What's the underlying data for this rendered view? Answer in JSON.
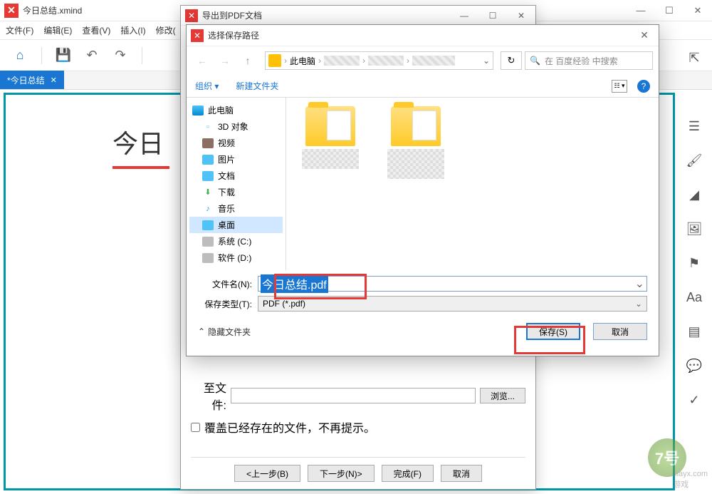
{
  "main": {
    "title": "今日总结.xmind",
    "menu": [
      "文件(F)",
      "编辑(E)",
      "查看(V)",
      "插入(I)",
      "修改("
    ],
    "tab_label": "*今日总结",
    "topic": "今日"
  },
  "right_tools": [
    "list-icon",
    "brush-icon",
    "triangle-icon",
    "image-icon",
    "flag-icon",
    "tag-icon",
    "doc-icon",
    "chat-icon",
    "clipboard-icon"
  ],
  "pdf_dialog": {
    "title": "导出到PDF文档",
    "to_file_label": "至文件:",
    "browse": "浏览...",
    "overwrite": "覆盖已经存在的文件，不再提示。",
    "prev": "<上一步(B)",
    "next": "下一步(N)>",
    "finish": "完成(F)",
    "cancel": "取消"
  },
  "save_dialog": {
    "title": "选择保存路径",
    "breadcrumb_pc": "此电脑",
    "search_placeholder": "在 百度经验 中搜索",
    "organize": "组织",
    "new_folder": "新建文件夹",
    "tree": {
      "pc": "此电脑",
      "items": [
        "3D 对象",
        "视频",
        "图片",
        "文档",
        "下载",
        "音乐",
        "桌面",
        "系统 (C:)",
        "软件 (D:)"
      ]
    },
    "filename_label": "文件名(N):",
    "filename_value": "今日总结.pdf",
    "filetype_label": "保存类型(T):",
    "filetype_value": "PDF (*.pdf)",
    "hide_folders": "隐藏文件夹",
    "save": "保存(S)",
    "cancel": "取消"
  },
  "watermark": {
    "site": "xiayx.com",
    "sub": "游戏"
  }
}
